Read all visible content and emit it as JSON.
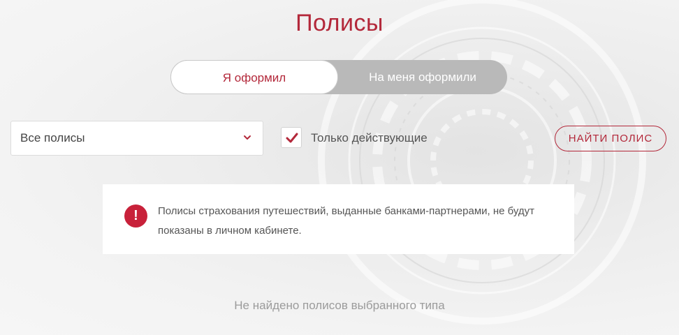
{
  "header": {
    "title": "Полисы"
  },
  "toggle": {
    "options": [
      {
        "label": "Я оформил",
        "active": true
      },
      {
        "label": "На меня оформили",
        "active": false
      }
    ]
  },
  "filters": {
    "policy_select": {
      "value": "Все полисы",
      "icon": "chevron-down-icon"
    },
    "active_only": {
      "label": "Только действующие",
      "checked": true,
      "icon": "checkmark-icon"
    },
    "find_button": "НАЙТИ ПОЛИС"
  },
  "notice": {
    "icon": "exclamation-icon",
    "icon_glyph": "!",
    "text": "Полисы страхования путешествий, выданные банками-партнерами, не будут показаны в личном кабинете."
  },
  "empty_state": "Не найдено полисов выбранного типа",
  "colors": {
    "accent": "#b3283a",
    "alert": "#c8213a",
    "toggle_inactive_bg": "#b9b9b9"
  }
}
